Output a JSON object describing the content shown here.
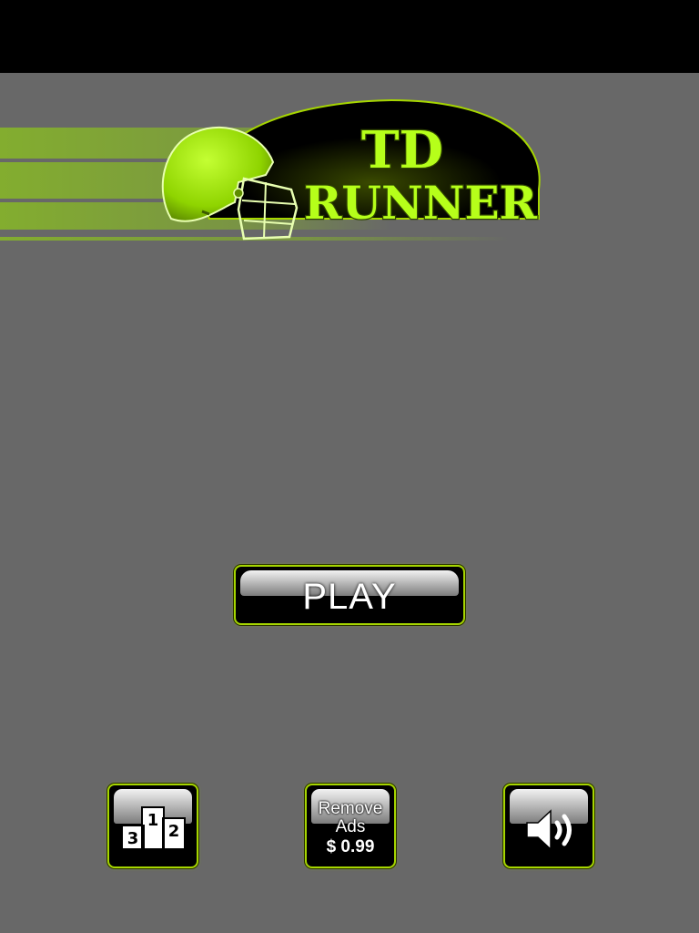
{
  "logo": {
    "line1": "TD",
    "line2": "RUNNER",
    "accent_color": "#99e600"
  },
  "buttons": {
    "play_label": "PLAY",
    "remove_ads_line1": "Remove",
    "remove_ads_line2": "Ads",
    "remove_ads_price": "$ 0.99"
  },
  "leaderboard_icon": {
    "name": "podium-icon",
    "places": [
      "1",
      "2",
      "3"
    ]
  },
  "sound_icon": {
    "name": "speaker-icon"
  },
  "colors": {
    "background": "#686868",
    "top_bar": "#000000",
    "button_border": "#a6d600",
    "button_fill": "#000000"
  }
}
